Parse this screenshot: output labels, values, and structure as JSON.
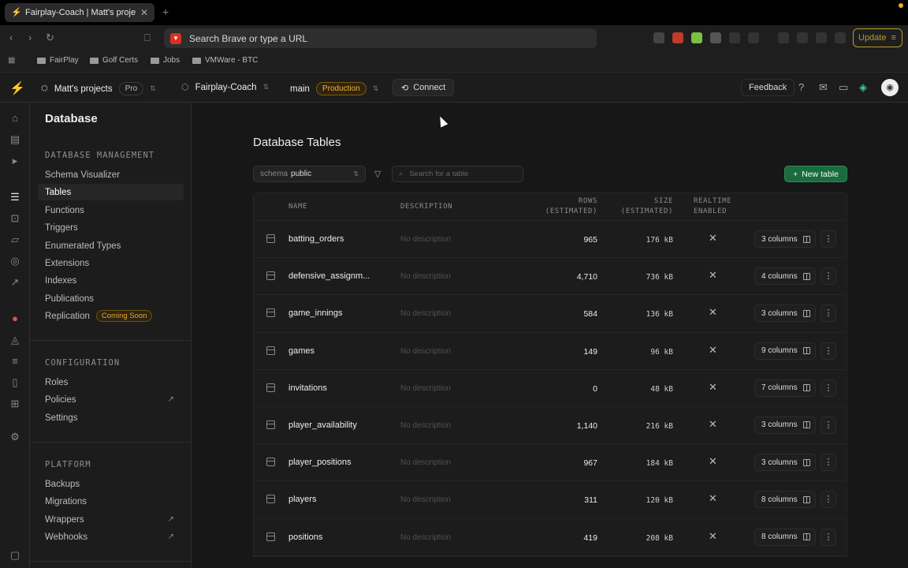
{
  "browser": {
    "tab_title": "Fairplay-Coach | Matt's project...",
    "tab_close": "✕",
    "new_tab": "+",
    "url_placeholder": "Search Brave or type a URL",
    "update_label": "Update",
    "bookmarks": [
      "FairPlay",
      "Golf Certs",
      "Jobs",
      "VMWare - BTC"
    ]
  },
  "header": {
    "org": "Matt's projects",
    "plan": "Pro",
    "project": "Fairplay-Coach",
    "branch": "main",
    "env": "Production",
    "connect_label": "Connect",
    "feedback_label": "Feedback"
  },
  "sidebar": {
    "title": "Database",
    "sections": [
      {
        "heading": "DATABASE MANAGEMENT",
        "items": [
          "Schema Visualizer",
          "Tables",
          "Functions",
          "Triggers",
          "Enumerated Types",
          "Extensions",
          "Indexes",
          "Publications",
          "Replication"
        ]
      },
      {
        "heading": "CONFIGURATION",
        "items": [
          "Roles",
          "Policies",
          "Settings"
        ]
      },
      {
        "heading": "PLATFORM",
        "items": [
          "Backups",
          "Migrations",
          "Wrappers",
          "Webhooks"
        ]
      }
    ],
    "coming_soon": "Coming Soon",
    "active_item": "Tables"
  },
  "main": {
    "title": "Database Tables",
    "schema_label": "schema",
    "schema_value": "public",
    "search_placeholder": "Search for a table",
    "new_table_label": "New table",
    "columns": {
      "name": "NAME",
      "description": "DESCRIPTION",
      "rows1": "ROWS",
      "rows2": "(ESTIMATED)",
      "size1": "SIZE",
      "size2": "(ESTIMATED)",
      "rt1": "REALTIME",
      "rt2": "ENABLED"
    },
    "rows": [
      {
        "name": "batting_orders",
        "description": "No description",
        "rows": "965",
        "size": "176 kB",
        "columns": "3 columns"
      },
      {
        "name": "defensive_assignm...",
        "description": "No description",
        "rows": "4,710",
        "size": "736 kB",
        "columns": "4 columns"
      },
      {
        "name": "game_innings",
        "description": "No description",
        "rows": "584",
        "size": "136 kB",
        "columns": "3 columns"
      },
      {
        "name": "games",
        "description": "No description",
        "rows": "149",
        "size": "96 kB",
        "columns": "9 columns"
      },
      {
        "name": "invitations",
        "description": "No description",
        "rows": "0",
        "size": "48 kB",
        "columns": "7 columns"
      },
      {
        "name": "player_availability",
        "description": "No description",
        "rows": "1,140",
        "size": "216 kB",
        "columns": "3 columns"
      },
      {
        "name": "player_positions",
        "description": "No description",
        "rows": "967",
        "size": "184 kB",
        "columns": "3 columns"
      },
      {
        "name": "players",
        "description": "No description",
        "rows": "311",
        "size": "120 kB",
        "columns": "8 columns"
      },
      {
        "name": "positions",
        "description": "No description",
        "rows": "419",
        "size": "208 kB",
        "columns": "8 columns"
      }
    ]
  }
}
